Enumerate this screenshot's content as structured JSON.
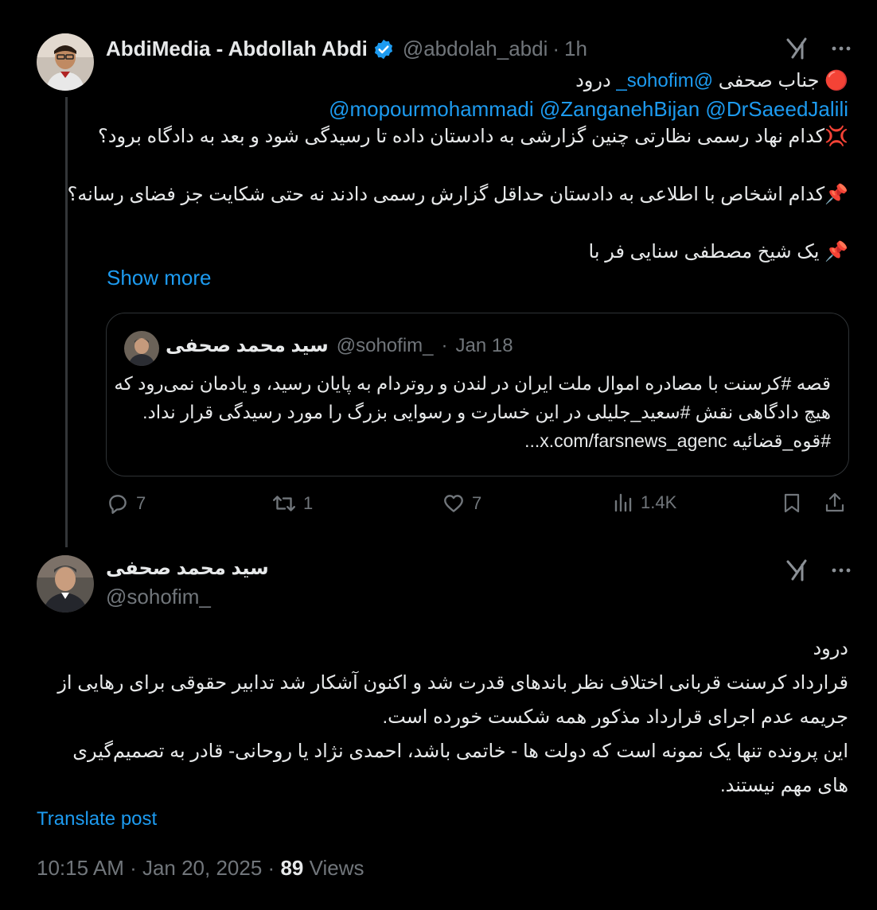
{
  "original_post": {
    "author_name": "AbdiMedia - Abdollah Abdi",
    "handle": "@abdolah_abdi",
    "separator": "·",
    "time": "1h",
    "lines": [
      {
        "prefix": "🔴 جناب صحفی ",
        "mention": "@sohofim_",
        "suffix": " درود"
      },
      {
        "mentions": "@mopourmohammadi @ZanganehBijan @DrSaeedJalili"
      },
      {
        "text": "💢کدام نهاد رسمی نظارتی چنین گزارشی به دادستان داده تا رسیدگی شود و بعد به دادگاه برود؟"
      },
      {
        "text": "📌کدام اشخاص با اطلاعی به دادستان حداقل گزارش رسمی دادند نه حتی شکایت جز فضای رسانه؟"
      },
      {
        "text": "📌 یک شیخ مصطفی سنایی فر با"
      }
    ],
    "show_more": "Show more"
  },
  "quoted_post": {
    "author_name": "سید محمد صحفی",
    "handle": "@sohofim_",
    "separator": "·",
    "date": "Jan 18",
    "lines": [
      "قصه #کرسنت با مصادره اموال ملت ایران در لندن و روتردام به پایان رسید، و یادمان نمی‌رود که",
      "هیچ دادگاهی نقش #سعید_جلیلی در این خسارت و رسوایی بزرگ را مورد رسیدگی قرار نداد.",
      "#قوه_قضائیه x.com/farsnews_agenc..."
    ]
  },
  "actions": {
    "replies": "7",
    "reposts": "1",
    "likes": "7",
    "views": "1.4K"
  },
  "reply_post": {
    "author_name": "سید محمد صحفی",
    "handle": "@sohofim_",
    "lines": [
      "درود",
      "قرارداد کرسنت قربانی اختلاف نظر باندهای قدرت شد و اکنون آشکار شد تدابیر حقوقی برای رهایی از",
      "جریمه عدم اجرای قرارداد مذکور همه شکست خورده است.",
      "این پرونده تنها یک نمونه است که دولت ها - خاتمی باشد، احمدی نژاد یا روحانی- قادر به تصمیم‌گیری",
      "های مهم نیستند."
    ],
    "translate": "Translate post",
    "timestamp": "10:15 AM · Jan 20, 2025 ·",
    "views_count": "89",
    "views_label": "Views"
  },
  "colors": {
    "background": "#000000",
    "text": "#e7e9ea",
    "muted": "#71767b",
    "accent": "#1d9bf0",
    "border": "#2f3336"
  },
  "icons": [
    "verified-badge-icon",
    "grok-icon",
    "more-icon",
    "reply-icon",
    "repost-icon",
    "like-icon",
    "views-icon",
    "bookmark-icon",
    "share-icon"
  ]
}
